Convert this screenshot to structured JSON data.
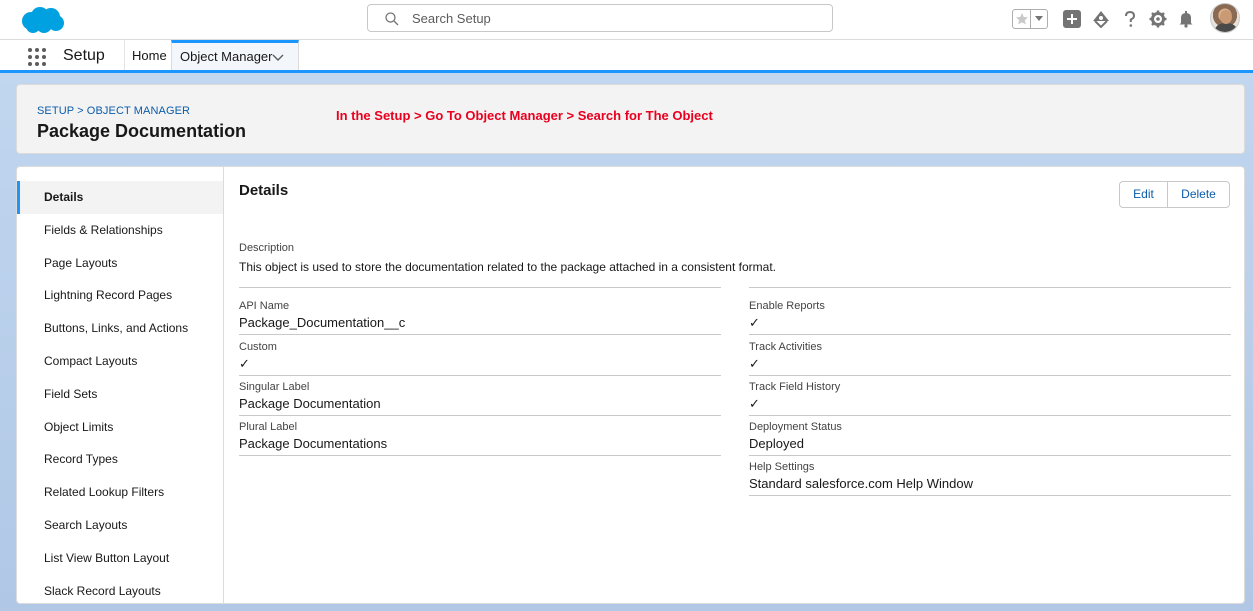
{
  "header": {
    "search_placeholder": "Search Setup",
    "brand_color": "#00a1e0"
  },
  "context_bar": {
    "app_name": "Setup",
    "nav_home": "Home",
    "nav_object_manager": "Object Manager"
  },
  "object_header": {
    "breadcrumb": "SETUP > OBJECT MANAGER",
    "title": "Package Documentation",
    "annotation": "In the Setup > Go To Object Manager > Search for The Object"
  },
  "sidebar": {
    "items": [
      {
        "label": "Details"
      },
      {
        "label": "Fields & Relationships"
      },
      {
        "label": "Page Layouts"
      },
      {
        "label": "Lightning Record Pages"
      },
      {
        "label": "Buttons, Links, and Actions"
      },
      {
        "label": "Compact Layouts"
      },
      {
        "label": "Field Sets"
      },
      {
        "label": "Object Limits"
      },
      {
        "label": "Record Types"
      },
      {
        "label": "Related Lookup Filters"
      },
      {
        "label": "Search Layouts"
      },
      {
        "label": "List View Button Layout"
      },
      {
        "label": "Slack Record Layouts"
      }
    ]
  },
  "details": {
    "title": "Details",
    "edit_label": "Edit",
    "delete_label": "Delete",
    "description_label": "Description",
    "description_value": "This object is used to store the documentation related to the package attached in a consistent format.",
    "left_fields": [
      {
        "label": "API Name",
        "value": "Package_Documentation__c"
      },
      {
        "label": "Custom",
        "value": "✓"
      },
      {
        "label": "Singular Label",
        "value": "Package Documentation"
      },
      {
        "label": "Plural Label",
        "value": "Package Documentations"
      }
    ],
    "right_fields": [
      {
        "label": "Enable Reports",
        "value": "✓"
      },
      {
        "label": "Track Activities",
        "value": "✓"
      },
      {
        "label": "Track Field History",
        "value": "✓"
      },
      {
        "label": "Deployment Status",
        "value": "Deployed"
      },
      {
        "label": "Help Settings",
        "value": "Standard salesforce.com Help Window"
      }
    ]
  }
}
